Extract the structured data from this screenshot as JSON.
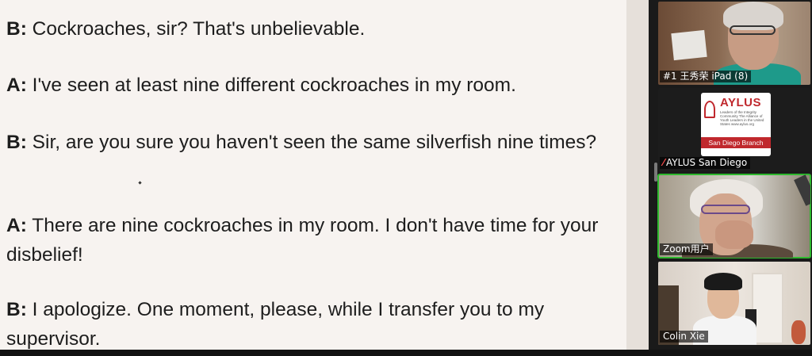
{
  "transcript": [
    {
      "speaker": "B:",
      "text": " Cockroaches, sir? That's unbelievable."
    },
    {
      "speaker": "A:",
      "text": " I've seen at least nine different cockroaches in my room."
    },
    {
      "speaker": "B:",
      "text": " Sir, are you sure you haven't seen the same silverfish nine times?"
    },
    {
      "speaker": "A:",
      "text": " There are nine cockroaches in my room. I don't have time for your disbelief!"
    },
    {
      "speaker": "B:",
      "text": " I apologize. One moment, please, while I transfer you to my supervisor."
    }
  ],
  "participants": [
    {
      "name": "#1 王秀荣 iPad (8)",
      "muted": false
    },
    {
      "name": "AYLUS San Diego",
      "muted": true
    },
    {
      "name": "Zoom用户",
      "muted": false,
      "active": true
    },
    {
      "name": "Colin Xie",
      "muted": false
    }
  ],
  "aylus_logo": {
    "title": "AYLUS",
    "tagline": "Leaders of the Integrity Community The Alliance of Youth Leaders in the United States www.aylus.org",
    "branch": "San Diego Branch"
  },
  "colors": {
    "doc_background": "#f7f3f0",
    "active_speaker": "#2eb82e",
    "aylus_red": "#c0282d"
  },
  "icons": [
    "muted-mic-icon"
  ]
}
